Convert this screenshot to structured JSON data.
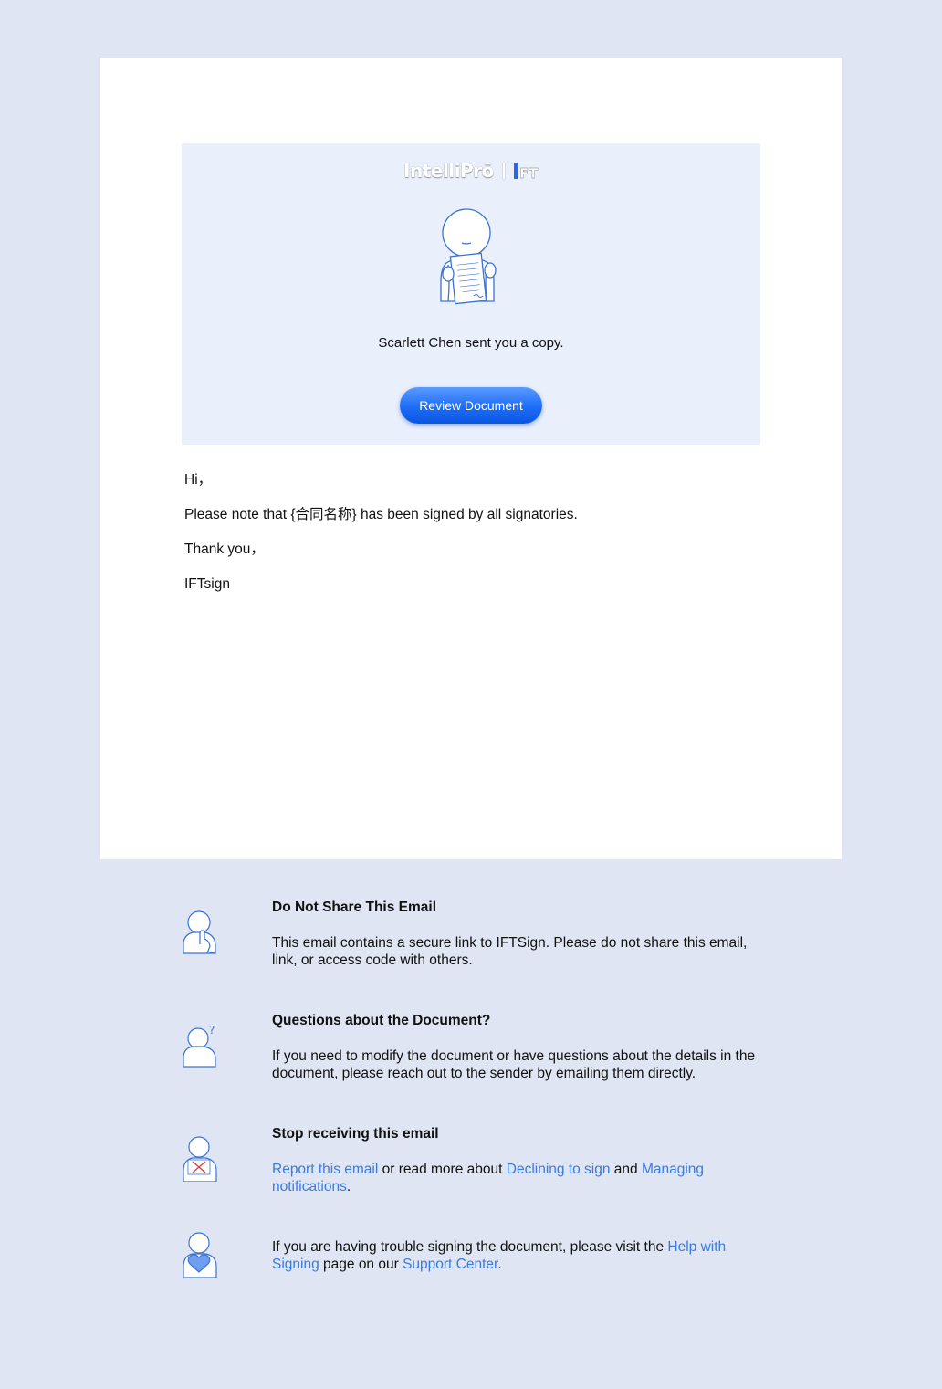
{
  "brand": {
    "logo_text": "IntelliPrō",
    "logo_mark_text": "FT"
  },
  "hero": {
    "message": "Scarlett Chen sent you a copy.",
    "button_label": "Review Document"
  },
  "email_body": {
    "greeting": "Hi，",
    "line1": "Please note that {合同名称} has been signed by all signatories.",
    "thanks": "Thank you，",
    "signature": "IFTsign"
  },
  "footer": {
    "share": {
      "title": "Do Not Share This Email",
      "desc": "This email contains a secure link to IFTSign. Please do not share this email, link, or access code with others."
    },
    "questions": {
      "title": "Questions about the Document?",
      "desc": "If you need to modify the document or have questions about the details in the document, please reach out to the sender by emailing them directly."
    },
    "stop": {
      "title": "Stop receiving this email",
      "link_report": "Report this email",
      "text1": " or read more about ",
      "link_declining": "Declining to sign",
      "text2": " and ",
      "link_managing": "Managing notifications",
      "text3": "."
    },
    "help": {
      "text1": "If you are having trouble signing the document, please visit the ",
      "link_help": "Help with Signing",
      "text2": " page on our ",
      "link_support": "Support Center",
      "text3": "."
    }
  },
  "colors": {
    "page_bg": "#dfe5f2",
    "hero_bg": "#e9effb",
    "accent": "#1e6cf7",
    "link": "#3a7be0"
  },
  "icons": [
    "brand-logo-mark",
    "person-with-document-illustration",
    "person-shush-icon",
    "person-question-icon",
    "person-decline-icon",
    "person-heart-icon"
  ]
}
